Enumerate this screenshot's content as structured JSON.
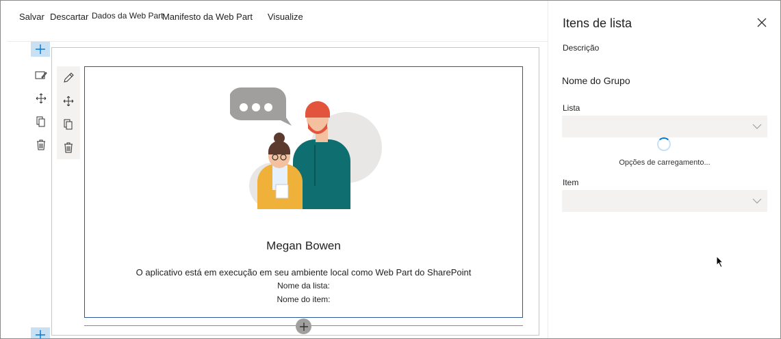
{
  "toolbar": {
    "save_label": "Salvar",
    "discard_label": "Descartar",
    "webpart_data_label": "Dados da Web Part",
    "manifest_label": "Manifesto da Web Part",
    "visualize_label": "Visualize"
  },
  "webpart": {
    "person_name": "Megan Bowen",
    "running_message": "O aplicativo está em execução em seu ambiente local como Web Part do SharePoint",
    "list_name_label": "Nome da lista:",
    "item_name_label": "Nome do item:"
  },
  "panel": {
    "title": "Itens de lista",
    "description_label": "Descrição",
    "group_name": "Nome do Grupo",
    "list_label": "Lista",
    "loading_text": "Opções de carregamento...",
    "item_label": "Item"
  },
  "colors": {
    "accent": "#0078d4",
    "add_button_bg": "#c7e0f4",
    "webpart_border": "#2b579a",
    "dropdown_bg": "#f3f2f1"
  },
  "icons": {
    "section_tools": [
      "edit-section-icon",
      "move-icon",
      "copy-icon",
      "delete-icon"
    ],
    "webpart_tools": [
      "pencil-icon",
      "move-icon",
      "copy-icon",
      "delete-icon"
    ],
    "illustration": "people-chat-illustration"
  }
}
